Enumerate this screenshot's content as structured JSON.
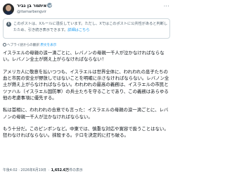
{
  "author": {
    "name": "איתמר בן גביר",
    "handle": "@itamarbengvir",
    "verified_badge_icon": "verified-badge-icon",
    "more_icon": "more-options-icon"
  },
  "notice": {
    "icon": "info-icon",
    "text": "このポストは、Xルールに違反しています。ただし、Xではこのポストに公共性があると判断したため、引き続き表示できます。",
    "link_label": "詳細はこちら"
  },
  "translation": {
    "label": "ヘブライ語からの翻訳",
    "link_label": "原文を表示"
  },
  "post": {
    "paragraphs": [
      "イスラエルの母親の涙一滴ごとに、レバノンの母親一千人が泣かなければならない。レバノン全土が燃え上がらなければならない！",
      "アメリカ人に敬意を払いつつも、イスラエルは世界全体に、われわれの息子たちの血と市民の安全が野放しではないことを明確に示さなければならない。レバノン全土が燃え上がらなければならない。われわれの最高の義務は、イスラエルの市民とツァハル（イスラエル国防軍）の兵士たちを守ることであり、この義務はあらゆる他の考慮事項に優先する。",
      "私は首相に、われわれの合意でも言った：イスラエルの母親の涙一滴ごとに、レバノンの母親一千人が泣かなければならない。",
      "もう十分だ。このピンポンなど。中東では、慎重な対応や寛容で扱うことはない。狂わなければならない。抹殺する。テロを決定的に打ち破る。"
    ]
  },
  "meta": {
    "time": "午後4:02 · 2026年6月19日",
    "views_count": "1,652.6万",
    "views_label": "件の表示"
  }
}
